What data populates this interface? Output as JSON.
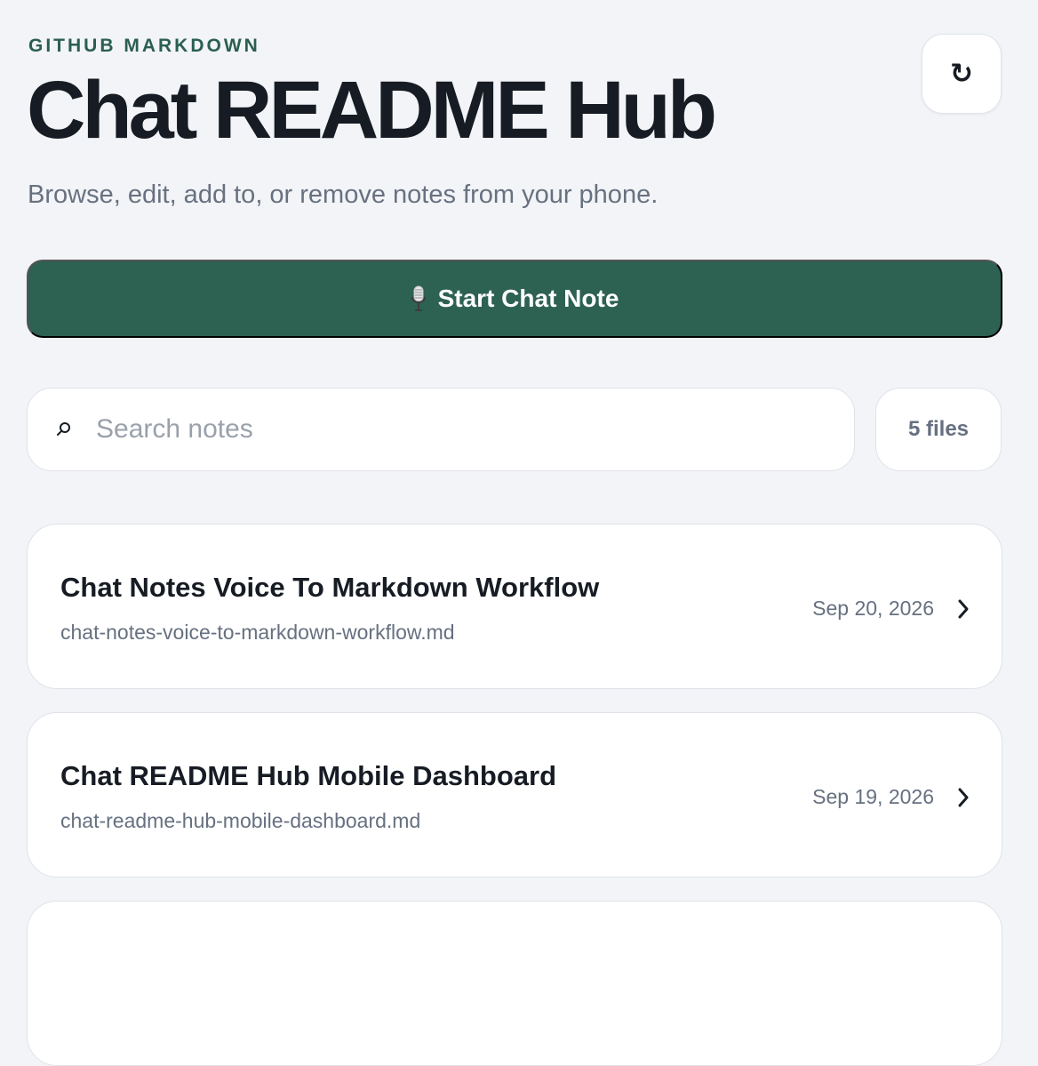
{
  "header": {
    "eyebrow": "GITHUB MARKDOWN",
    "title": "Chat README Hub",
    "subtitle": "Browse, edit, add to, or remove notes from your phone.",
    "refresh_icon": "refresh-icon",
    "refresh_symbol": "↻"
  },
  "actions": {
    "start_label": "Start Chat Note",
    "start_icon": "microphone-icon"
  },
  "search": {
    "placeholder": "Search notes",
    "value": "",
    "icon": "search-icon"
  },
  "files": {
    "count_label": "5 files"
  },
  "notes": [
    {
      "title": "Chat Notes Voice To Markdown Workflow",
      "filename": "chat-notes-voice-to-markdown-workflow.md",
      "date": "Sep 20, 2026",
      "icon": "chevron-right-icon"
    },
    {
      "title": "Chat README Hub Mobile Dashboard",
      "filename": "chat-readme-hub-mobile-dashboard.md",
      "date": "Sep 19, 2026",
      "icon": "chevron-right-icon"
    }
  ],
  "colors": {
    "background": "#f2f4f7",
    "accent": "#2d6152",
    "eyebrow": "#2b5f4f",
    "heading": "#171c24",
    "muted": "#667080",
    "card": "#ffffff"
  }
}
